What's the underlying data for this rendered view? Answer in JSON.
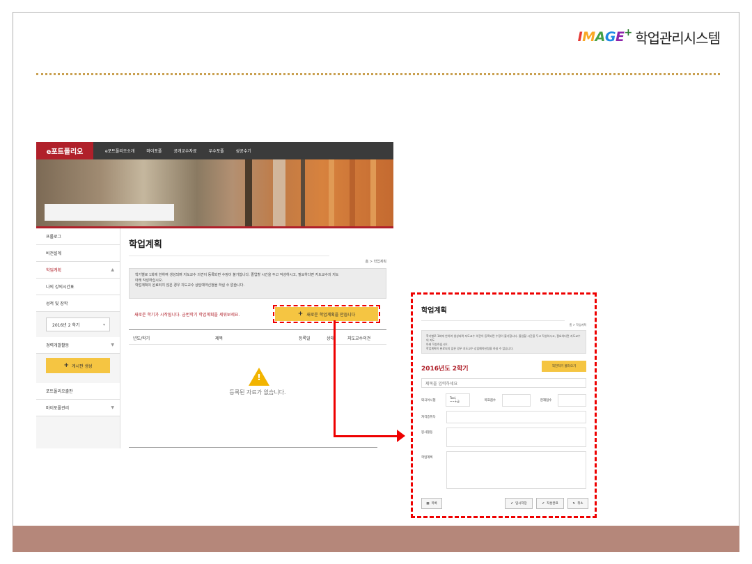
{
  "brand": {
    "logo_text": "IMAGE",
    "plus": "+",
    "system_name": "학업관리시스템"
  },
  "topnav": {
    "logo": "e포트폴리오",
    "items": [
      "e포트폴리오소개",
      "마이포폴",
      "공개교수자료",
      "우수포폴",
      "성공수기"
    ]
  },
  "sidebar": {
    "items": [
      {
        "label": "프롤로그"
      },
      {
        "label": "비전설계"
      },
      {
        "label": "학업계획",
        "active": true
      },
      {
        "label": "나의 강의시간표"
      },
      {
        "label": "성적 및 장학"
      }
    ],
    "semester_select": "2016년 2 학기",
    "career": "경력개발활동",
    "new_post_button": "게시판 생성",
    "items2": [
      {
        "label": "포트폴리오출판"
      },
      {
        "label": "마이포폴관리"
      }
    ]
  },
  "main": {
    "title": "학업계획",
    "breadcrumb": "홈 > 학업계획",
    "notice_line1": "학기별로 1회에 한하여 생성되며 지도교수 의견이 등록되면 수정이 불가합니다. 졸업할 시간을 두고 작성하시고, 필요하다면 지도교수의 지도",
    "notice_line2": "아래 작성하십시오.",
    "notice_line3": "학업계획이 완료되지 않은 경우 지도교수 상담예약신청을 하실 수 없습니다.",
    "message": "새로운 학기가 시작됩니다. 금번학기 학업계획을 세워보세요.",
    "new_button": "새로운 학업계획을 만듭니다",
    "columns": [
      "년도/학기",
      "제목",
      "등록일",
      "상태",
      "지도교수의견"
    ],
    "empty": "등록된 자료가 없습니다."
  },
  "zoom": {
    "title": "학업계획",
    "breadcrumb": "홈 > 학업계획",
    "notice_line1": "학기별로 1회에 한하여 생성되며 지도교수 의견이 등록되면 수정이 불가합니다. 졸업할 시간을 두고 작성하시고, 필요하다면 지도교수의 지도",
    "notice_line2": "아래 작성하십시오.",
    "notice_line3": "학업계획이 완료되지 않은 경우 지도교수 상담예약신청을 하실 수 없습니다.",
    "semester": "2016년도 2학기",
    "load_button": "직전학기 불러오기",
    "title_placeholder": "제목을 입력하세요",
    "lang_label": "외국어시험",
    "lang_select": "Tool, ~~+급",
    "target_label": "목표점수",
    "current_label": "현재점수",
    "cert_label": "자격증취득",
    "volunteer_label": "봉사활동",
    "study_label": "학업계획",
    "list_button": "목록",
    "save_temp_button": "임시저장",
    "complete_button": "작성완료",
    "cancel_button": "취소"
  }
}
